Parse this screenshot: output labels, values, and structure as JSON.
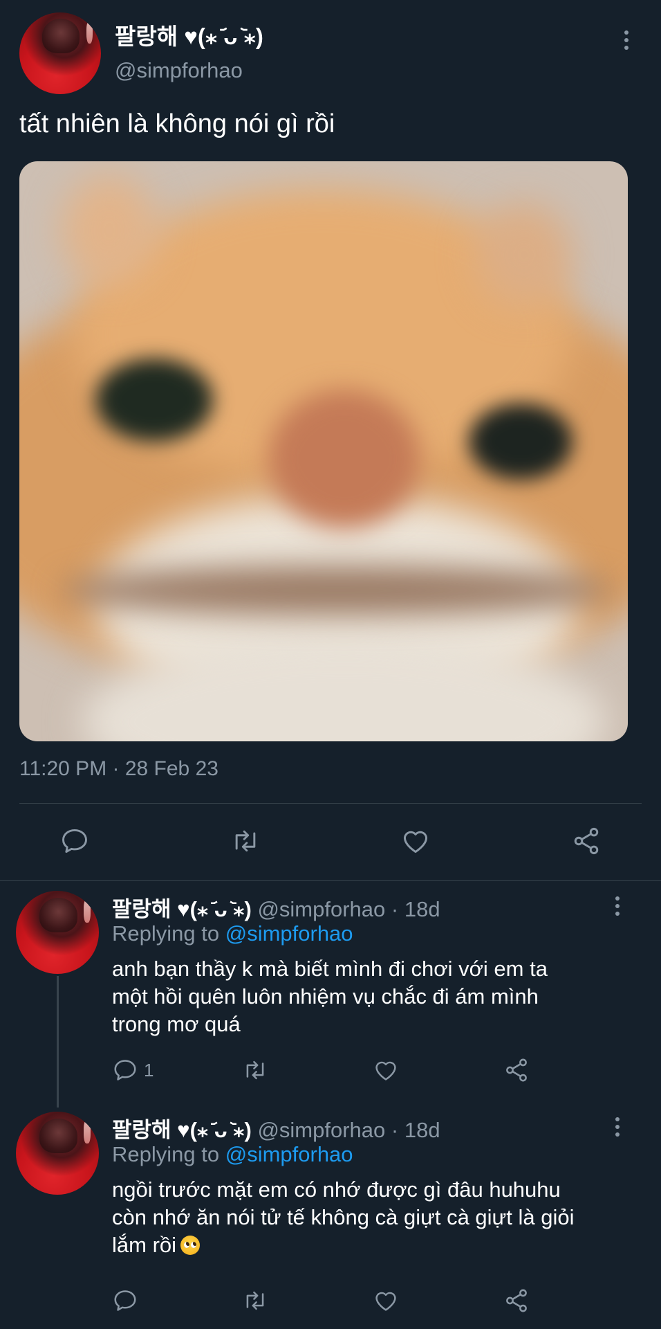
{
  "main_tweet": {
    "display_name": "팔랑해 ♥(⁎ ᷄ᴗ ᷅⁎)",
    "handle": "@simpforhao",
    "text": "tất nhiên là không nói gì rồi",
    "media_icon": "photo-blurred-cat-closeup",
    "timestamp": "11:20 PM · 28 Feb 23",
    "actions": {
      "reply_icon": "speech-bubble-icon",
      "retweet_icon": "retweet-icon",
      "like_icon": "heart-icon",
      "share_icon": "share-icon"
    }
  },
  "replies": [
    {
      "display_name": "팔랑해 ♥(⁎ ᷄ᴗ ᷅⁎)",
      "handle": "@simpforhao",
      "separator": "·",
      "age": "18d",
      "replying_prefix": "Replying to",
      "replying_to": "@simpforhao",
      "lines": [
        "anh bạn thầy k mà biết mình đi chơi với em ta",
        "một hồi quên luôn nhiệm vụ chắc đi ám mình",
        "trong mơ quá"
      ],
      "reply_count": "1"
    },
    {
      "display_name": "팔랑해 ♥(⁎ ᷄ᴗ ᷅⁎)",
      "handle": "@simpforhao",
      "separator": "·",
      "age": "18d",
      "replying_prefix": "Replying to",
      "replying_to": "@simpforhao",
      "lines": [
        "ngồi trước mặt em có nhớ được gì đâu huhuhu",
        "còn nhớ ăn nói tử tế không cà giựt cà giựt là giỏi",
        "lắm rồi"
      ],
      "emoji": "pleading-face-emoji",
      "reply_count": ""
    }
  ],
  "colors": {
    "background": "#15202b",
    "text_primary": "#ffffff",
    "text_secondary": "#8b98a5",
    "link": "#1d9bf0",
    "divider": "#38444d"
  }
}
